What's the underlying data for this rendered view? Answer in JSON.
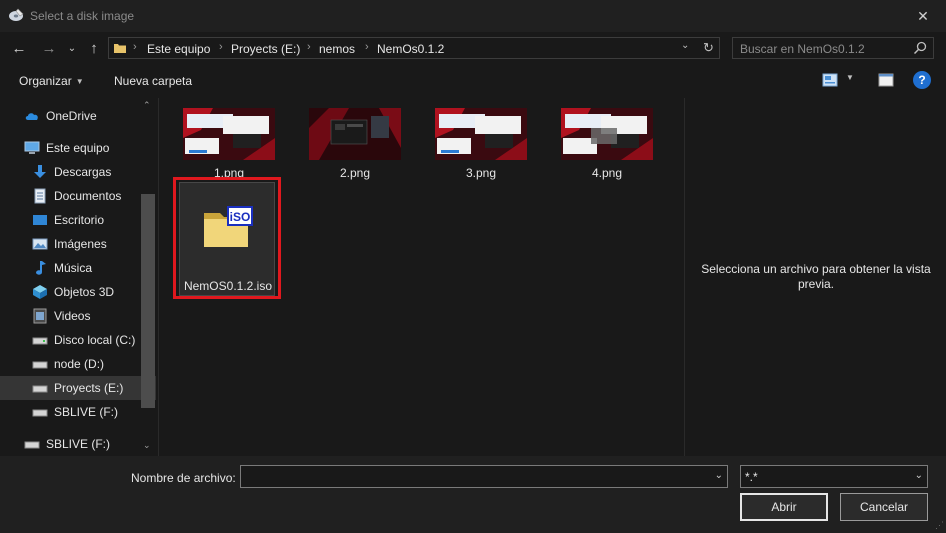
{
  "window": {
    "title": "Select a disk image",
    "close": "✕"
  },
  "nav": {
    "back": "←",
    "forward": "→",
    "recent": "⌄",
    "up": "↑",
    "crumbs": [
      "Este equipo",
      "Proyects (E:)",
      "nemos",
      "NemOs0.1.2"
    ],
    "separator": "›",
    "search_placeholder": "Buscar en NemOs0.1.2"
  },
  "toolbar": {
    "organize": "Organizar",
    "new_folder": "Nueva carpeta",
    "help": "?"
  },
  "sidebar": {
    "items": [
      {
        "label": "OneDrive",
        "icon": "onedrive-icon"
      },
      {
        "label": "Este equipo",
        "icon": "computer-icon"
      },
      {
        "label": "Descargas",
        "icon": "downloads-icon"
      },
      {
        "label": "Documentos",
        "icon": "documents-icon"
      },
      {
        "label": "Escritorio",
        "icon": "desktop-icon"
      },
      {
        "label": "Imágenes",
        "icon": "pictures-icon"
      },
      {
        "label": "Música",
        "icon": "music-icon"
      },
      {
        "label": "Objetos 3D",
        "icon": "3d-objects-icon"
      },
      {
        "label": "Videos",
        "icon": "videos-icon"
      },
      {
        "label": "Disco local (C:)",
        "icon": "drive-icon"
      },
      {
        "label": "node (D:)",
        "icon": "drive-icon"
      },
      {
        "label": "Proyects (E:)",
        "icon": "drive-icon",
        "selected": true
      },
      {
        "label": "SBLIVE (F:)",
        "icon": "drive-icon"
      },
      {
        "label": "SBLIVE (F:)",
        "icon": "drive-icon"
      }
    ]
  },
  "files": [
    {
      "name": "1.png",
      "kind": "screenshot"
    },
    {
      "name": "2.png",
      "kind": "dark-desktop"
    },
    {
      "name": "3.png",
      "kind": "screenshot"
    },
    {
      "name": "4.png",
      "kind": "screenshot"
    },
    {
      "name": "NemOS0.1.2.iso",
      "kind": "iso",
      "icon_text": "iSO",
      "highlighted": true
    }
  ],
  "preview": {
    "message": "Selecciona un archivo para obtener la vista previa."
  },
  "bottom": {
    "filename_label": "Nombre de archivo:",
    "filename_value": "",
    "filter_value": "*.*",
    "open_button": "Abrir",
    "cancel_button": "Cancelar"
  },
  "colors": {
    "accent": "#1f6fd1",
    "highlight": "#e0181e",
    "background": "#191919"
  }
}
